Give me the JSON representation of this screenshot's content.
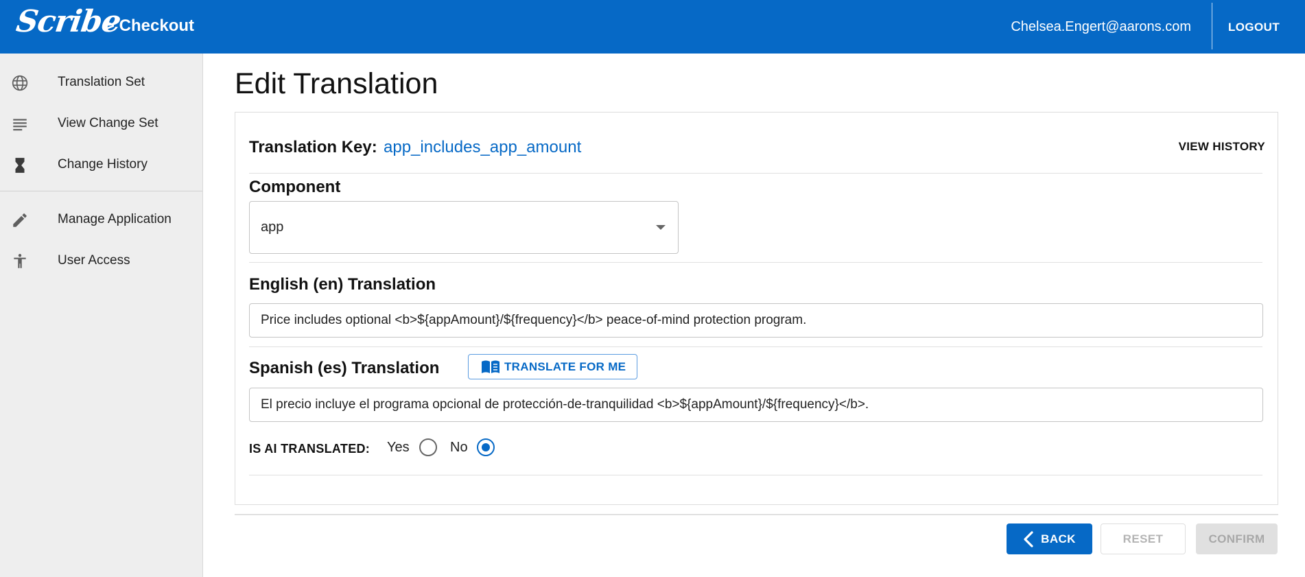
{
  "header": {
    "logo_text": "Scribe",
    "breadcrumb": "> Checkout",
    "user_email": "Chelsea.Engert@aarons.com",
    "logout_label": "LOGOUT"
  },
  "sidebar": {
    "items": [
      {
        "label": "Translation Set",
        "icon": "globe-icon"
      },
      {
        "label": "View Change Set",
        "icon": "list-lines-icon"
      },
      {
        "label": "Change History",
        "icon": "hourglass-icon"
      },
      {
        "label": "Manage Application",
        "icon": "pencil-icon"
      },
      {
        "label": "User Access",
        "icon": "accessibility-icon"
      }
    ]
  },
  "page": {
    "title": "Edit Translation"
  },
  "form": {
    "key_label": "Translation Key:",
    "key_value": "app_includes_app_amount",
    "view_history_label": "VIEW HISTORY",
    "component_label": "Component",
    "component_value": "app",
    "english_label": "English (en) Translation",
    "english_value": "Price includes optional <b>${appAmount}/${frequency}</b> peace-of-mind protection program.",
    "spanish_label": "Spanish (es) Translation",
    "translate_button_label": "TRANSLATE FOR ME",
    "spanish_value": "El precio incluye el programa opcional de protección-de-tranquilidad <b>${appAmount}/${frequency}</b>.",
    "ai_translated_label": "IS AI TRANSLATED:",
    "ai_options": [
      "Yes",
      "No"
    ],
    "ai_selected": "No"
  },
  "actions": {
    "back_label": "BACK",
    "reset_label": "RESET",
    "confirm_label": "CONFIRM"
  },
  "colors": {
    "primary": "#0669c6",
    "sidebar_bg": "#eeeeee",
    "disabled_bg": "#e0e0e0"
  }
}
